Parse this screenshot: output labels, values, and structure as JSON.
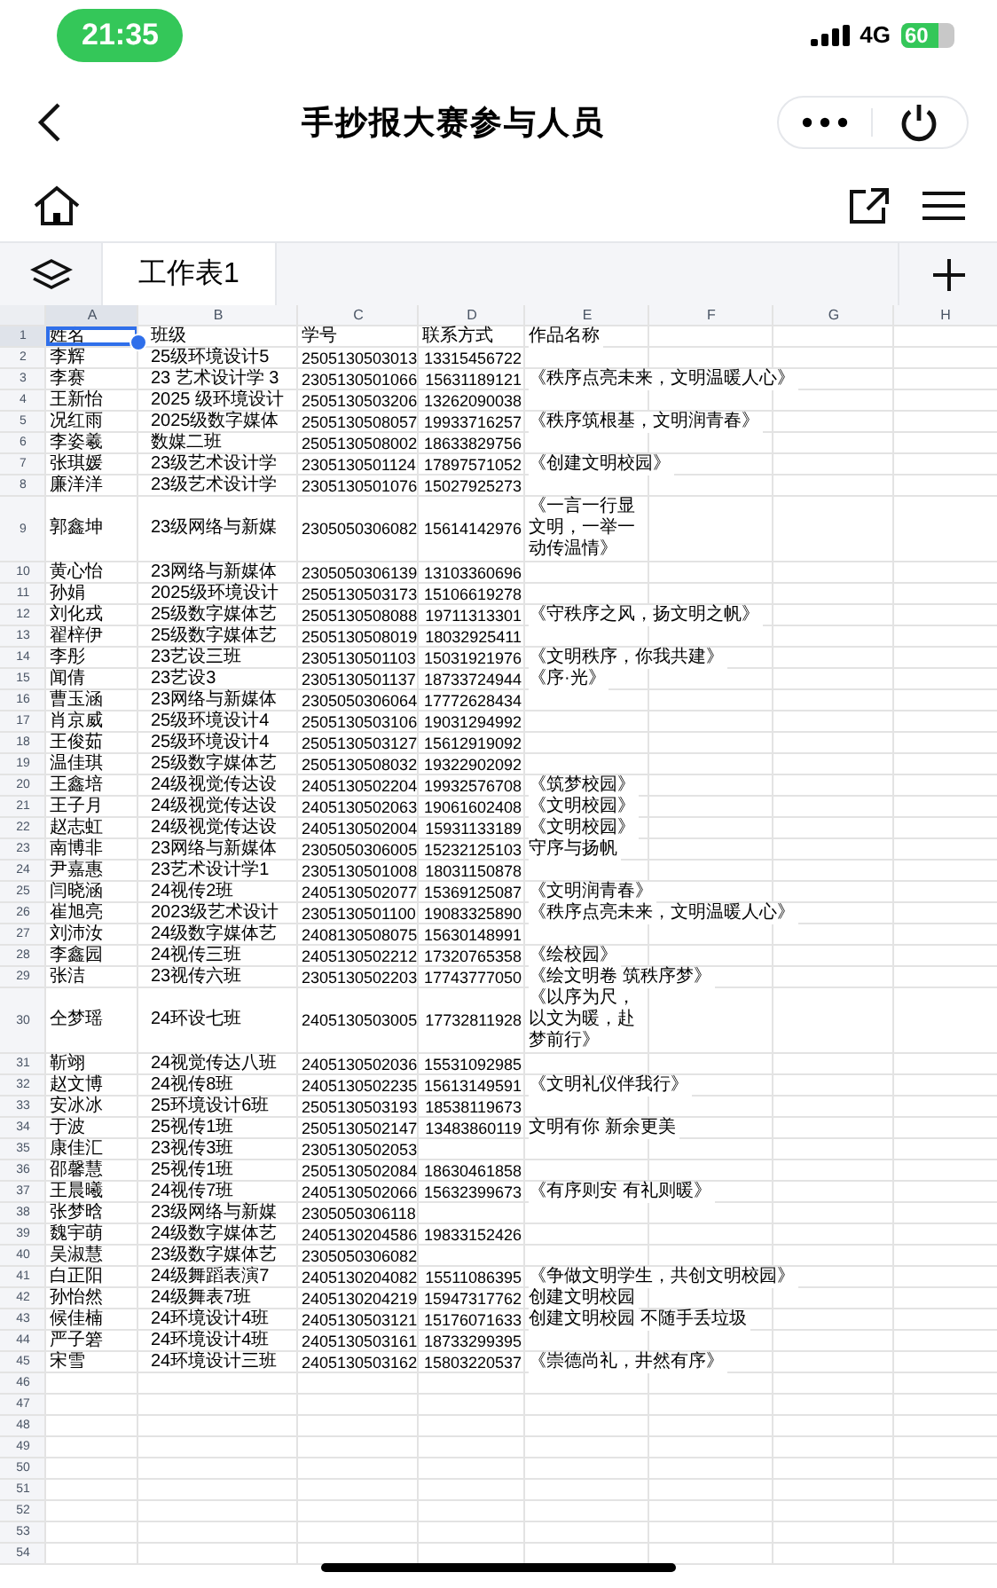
{
  "status_bar": {
    "time": "21:35",
    "network": "4G",
    "battery": "60"
  },
  "title_bar": {
    "title": "手抄报大赛参与人员"
  },
  "sheet_tabs": [
    {
      "label": "工作表1",
      "selected": true
    }
  ],
  "columns": [
    {
      "label": "A",
      "selected": true
    },
    {
      "label": "B",
      "selected": false
    },
    {
      "label": "C",
      "selected": false
    },
    {
      "label": "D",
      "selected": false
    },
    {
      "label": "E",
      "selected": false
    },
    {
      "label": "F",
      "selected": false
    },
    {
      "label": "G",
      "selected": false
    },
    {
      "label": "H",
      "selected": false
    }
  ],
  "rows": [
    {
      "number": "1",
      "kind": "header",
      "selected": true,
      "name": "姓名",
      "class": "班级",
      "student_no": "学号",
      "phone": "联系方式",
      "work": "作品名称"
    },
    {
      "number": "2",
      "kind": "record",
      "selected": false,
      "name": "李辉",
      "class": "25级环境设计5",
      "student_no": "2505130503013",
      "phone": "13315456722"
    },
    {
      "number": "3",
      "kind": "record",
      "selected": false,
      "name": "李赛",
      "class": "23 艺术设计学 3",
      "student_no": "2305130501066",
      "phone": "15631189121",
      "work": "《秩序点亮未来，文明温暖人心》"
    },
    {
      "number": "4",
      "kind": "record",
      "selected": false,
      "name": "王新怡",
      "class": "2025 级环境设计",
      "student_no": "2505130503206",
      "phone": "13262090038"
    },
    {
      "number": "5",
      "kind": "record",
      "selected": false,
      "name": "况红雨",
      "class": "2025级数字媒体",
      "student_no": "2505130508057",
      "phone": "19933716257",
      "work": "《秩序筑根基，文明润青春》"
    },
    {
      "number": "6",
      "kind": "record",
      "selected": false,
      "name": "李姿羲",
      "class": "数媒二班",
      "student_no": "2505130508002",
      "phone": "18633829756"
    },
    {
      "number": "7",
      "kind": "record",
      "selected": false,
      "name": "张琪媛",
      "class": "23级艺术设计学",
      "student_no": "2305130501124",
      "phone": "17897571052",
      "work": "《创建文明校园》"
    },
    {
      "number": "8",
      "kind": "record",
      "selected": false,
      "name": "廉洋洋",
      "class": "23级艺术设计学",
      "student_no": "2305130501076",
      "phone": "15027925273"
    },
    {
      "number": "9",
      "kind": "tall",
      "selected": false,
      "name": "郭鑫坤",
      "class": "23级网络与新媒",
      "student_no": "2305050306082",
      "phone": "15614142976",
      "work": "《一言一行显文明，一举一动传温情》"
    },
    {
      "number": "10",
      "kind": "record",
      "selected": false,
      "name": "黄心怡",
      "class": "23网络与新媒体",
      "student_no": "2305050306139",
      "phone": "13103360696"
    },
    {
      "number": "11",
      "kind": "record",
      "selected": false,
      "name": "孙娟",
      "class": "2025级环境设计",
      "student_no": "2505130503173",
      "phone": "15106619278"
    },
    {
      "number": "12",
      "kind": "record",
      "selected": false,
      "name": "刘化戎",
      "class": "25级数字媒体艺",
      "student_no": "2505130508088",
      "phone": "19711313301",
      "work": "《守秩序之风，扬文明之帆》"
    },
    {
      "number": "13",
      "kind": "record",
      "selected": false,
      "name": "翟梓伊",
      "class": "25级数字媒体艺",
      "student_no": "2505130508019",
      "phone": "18032925411"
    },
    {
      "number": "14",
      "kind": "record",
      "selected": false,
      "name": "李彤",
      "class": "23艺设三班",
      "student_no": "2305130501103",
      "phone": "15031921976",
      "work": "《文明秩序，你我共建》"
    },
    {
      "number": "15",
      "kind": "record",
      "selected": false,
      "name": "闻倩",
      "class": "23艺设3",
      "student_no": "2305130501137",
      "phone": "18733724944",
      "work": "《序·光》"
    },
    {
      "number": "16",
      "kind": "record",
      "selected": false,
      "name": "曹玉涵",
      "class": "23网络与新媒体",
      "student_no": "2305050306064",
      "phone": "17772628434"
    },
    {
      "number": "17",
      "kind": "record",
      "selected": false,
      "name": "肖京威",
      "class": "25级环境设计4",
      "student_no": "2505130503106",
      "phone": "19031294992"
    },
    {
      "number": "18",
      "kind": "record",
      "selected": false,
      "name": "王俊茹",
      "class": "25级环境设计4",
      "student_no": "2505130503127",
      "phone": "15612919092"
    },
    {
      "number": "19",
      "kind": "record",
      "selected": false,
      "name": "温佳琪",
      "class": "25级数字媒体艺",
      "student_no": "2505130508032",
      "phone": "19322902092"
    },
    {
      "number": "20",
      "kind": "record",
      "selected": false,
      "name": "王鑫培",
      "class": "24级视觉传达设",
      "student_no": "2405130502204",
      "phone": "19932576708",
      "work": "《筑梦校园》"
    },
    {
      "number": "21",
      "kind": "record",
      "selected": false,
      "name": "王子月",
      "class": "24级视觉传达设",
      "student_no": "2405130502063",
      "phone": "19061602408",
      "work": "《文明校园》"
    },
    {
      "number": "22",
      "kind": "record",
      "selected": false,
      "name": "赵志虹",
      "class": "24级视觉传达设",
      "student_no": "2405130502004",
      "phone": "15931133189",
      "work": "《文明校园》"
    },
    {
      "number": "23",
      "kind": "record",
      "selected": false,
      "name": "南博非",
      "class": "23网络与新媒体",
      "student_no": "2305050306005",
      "phone": "15232125103",
      "work": "守序与扬帆"
    },
    {
      "number": "24",
      "kind": "record",
      "selected": false,
      "name": "尹嘉惠",
      "class": "23艺术设计学1",
      "student_no": "2305130501008",
      "phone": "18031150878"
    },
    {
      "number": "25",
      "kind": "record",
      "selected": false,
      "name": "闫晓涵",
      "class": "24视传2班",
      "student_no": "2405130502077",
      "phone": "15369125087",
      "work": "《文明润青春》"
    },
    {
      "number": "26",
      "kind": "record",
      "selected": false,
      "name": "崔旭亮",
      "class": "2023级艺术设计",
      "student_no": "2305130501100",
      "phone": "19083325890",
      "work": "《秩序点亮未来，文明温暖人心》"
    },
    {
      "number": "27",
      "kind": "record",
      "selected": false,
      "name": "刘沛汝",
      "class": "24级数字媒体艺",
      "student_no": "2408130508075",
      "phone": "15630148991"
    },
    {
      "number": "28",
      "kind": "record",
      "selected": false,
      "name": "李鑫园",
      "class": "24视传三班",
      "student_no": "2405130502212",
      "phone": "17320765358",
      "work": "《绘校园》"
    },
    {
      "number": "29",
      "kind": "record",
      "selected": false,
      "name": "张洁",
      "class": "23视传六班",
      "student_no": "2305130502203",
      "phone": "17743777050",
      "work": "《绘文明卷 筑秩序梦》"
    },
    {
      "number": "30",
      "kind": "tall",
      "selected": false,
      "name": "仝梦瑶",
      "class": "24环设七班",
      "student_no": "2405130503005",
      "phone": "17732811928",
      "work": "《以序为尺，以文为暖，赴梦前行》"
    },
    {
      "number": "31",
      "kind": "record",
      "selected": false,
      "name": "靳翊",
      "class": "24视觉传达八班",
      "student_no": "2405130502036",
      "phone": "15531092985"
    },
    {
      "number": "32",
      "kind": "record",
      "selected": false,
      "name": "赵文博",
      "class": "24视传8班",
      "student_no": "2405130502235",
      "phone": "15613149591",
      "work": "《文明礼仪伴我行》"
    },
    {
      "number": "33",
      "kind": "record",
      "selected": false,
      "name": "安冰冰",
      "class": "25环境设计6班",
      "student_no": "2505130503193",
      "phone": "18538119673"
    },
    {
      "number": "34",
      "kind": "record",
      "selected": false,
      "name": "于波",
      "class": "25视传1班",
      "student_no": "2505130502147",
      "phone": "13483860119",
      "work": "文明有你 新余更美"
    },
    {
      "number": "35",
      "kind": "record",
      "selected": false,
      "name": "康佳汇",
      "class": "23视传3班",
      "student_no": "2305130502053"
    },
    {
      "number": "36",
      "kind": "record",
      "selected": false,
      "name": "邵馨慧",
      "class": "25视传1班",
      "student_no": "2505130502084",
      "phone": "18630461858"
    },
    {
      "number": "37",
      "kind": "record",
      "selected": false,
      "name": "王晨曦",
      "class": "24视传7班",
      "student_no": "2405130502066",
      "phone": "15632399673",
      "work": "《有序则安 有礼则暖》"
    },
    {
      "number": "38",
      "kind": "record",
      "selected": false,
      "name": "张梦晗",
      "class": "23级网络与新媒",
      "student_no": "2305050306118"
    },
    {
      "number": "39",
      "kind": "record",
      "selected": false,
      "name": "魏宇萌",
      "class": "24级数字媒体艺",
      "student_no": "2405130204586",
      "phone": "19833152426"
    },
    {
      "number": "40",
      "kind": "record",
      "selected": false,
      "name": "吴淑慧",
      "class": "23级数字媒体艺",
      "student_no": "2305050306082"
    },
    {
      "number": "41",
      "kind": "record",
      "selected": false,
      "name": "白正阳",
      "class": "24级舞蹈表演7",
      "student_no": "2405130204082",
      "phone": "15511086395",
      "work": "《争做文明学生，共创文明校园》"
    },
    {
      "number": "42",
      "kind": "record",
      "selected": false,
      "name": "孙怡然",
      "class": "24级舞表7班",
      "student_no": "2405130204219",
      "phone": "15947317762",
      "work": "创建文明校园"
    },
    {
      "number": "43",
      "kind": "record",
      "selected": false,
      "name": "候佳楠",
      "class": "24环境设计4班",
      "student_no": "2405130503121",
      "phone": "15176071633",
      "work": "创建文明校园 不随手丢垃圾"
    },
    {
      "number": "44",
      "kind": "record",
      "selected": false,
      "name": "严子箬",
      "class": "24环境设计4班",
      "student_no": "2405130503161",
      "phone": "18733299395"
    },
    {
      "number": "45",
      "kind": "record",
      "selected": false,
      "name": "宋雪",
      "class": "24环境设计三班",
      "student_no": "2405130503162",
      "phone": "15803220537",
      "work": "《崇德尚礼，井然有序》"
    },
    {
      "number": "46",
      "kind": "record",
      "selected": false
    },
    {
      "number": "47",
      "kind": "record",
      "selected": false
    },
    {
      "number": "48",
      "kind": "record",
      "selected": false
    },
    {
      "number": "49",
      "kind": "record",
      "selected": false
    },
    {
      "number": "50",
      "kind": "record",
      "selected": false
    },
    {
      "number": "51",
      "kind": "record",
      "selected": false
    },
    {
      "number": "52",
      "kind": "record",
      "selected": false
    },
    {
      "number": "53",
      "kind": "record",
      "selected": false
    },
    {
      "number": "54",
      "kind": "record",
      "selected": false
    }
  ]
}
